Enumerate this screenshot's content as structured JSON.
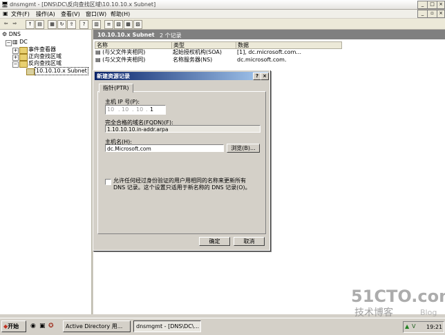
{
  "window": {
    "title": "dnsmgmt - [DNS\\DC\\反向查找区域\\10.10.10.x Subnet]"
  },
  "menu": [
    "文件(F)",
    "操作(A)",
    "查看(V)",
    "窗口(W)",
    "帮助(H)"
  ],
  "tree": {
    "root": "DNS",
    "server": "DC",
    "event_viewer": "事件查看器",
    "forward_zones": "正向查找区域",
    "reverse_zones": "反向查找区域",
    "subnet": "10.10.10.x Subnet"
  },
  "right": {
    "header_title": "10.10.10.x Subnet",
    "header_count": "2 个记录",
    "columns": [
      "名称",
      "类型",
      "数据"
    ],
    "rows": [
      [
        "(与父文件夹相同)",
        "起始授权机构(SOA)",
        "[1], dc.microsoft.com..."
      ],
      [
        "(与父文件夹相同)",
        "名称服务器(NS)",
        "dc.microsoft.com."
      ]
    ]
  },
  "dialog": {
    "title": "新建资源记录",
    "help": "?",
    "close": "×",
    "tab": "指针(PTR)",
    "ip_label": "主机 IP 号(P):",
    "ip_octets": [
      "10",
      "10",
      "10",
      "1"
    ],
    "fqdn_label": "完全合格的域名(FQDN)(F):",
    "fqdn_value": "1.10.10.10.in-addr.arpa",
    "host_label": "主机名(H):",
    "host_value": "dc.Microsoft.com",
    "browse": "浏览(B)...",
    "checkbox_text": "允许任何经过身份验证的用户用相同的名称来更新所有 DNS 记录。这个设置只适用于新名称的 DNS 记录(O)。",
    "ok": "确定",
    "cancel": "取消"
  },
  "taskbar": {
    "start": "开始",
    "tasks": [
      "Active Directory 用...",
      "dnsmgmt - [DNS\\DC\\..."
    ],
    "clock": "19:21"
  },
  "watermark": {
    "site": "51CTO.com",
    "blog": "技术博客",
    "tag": "Blog"
  }
}
